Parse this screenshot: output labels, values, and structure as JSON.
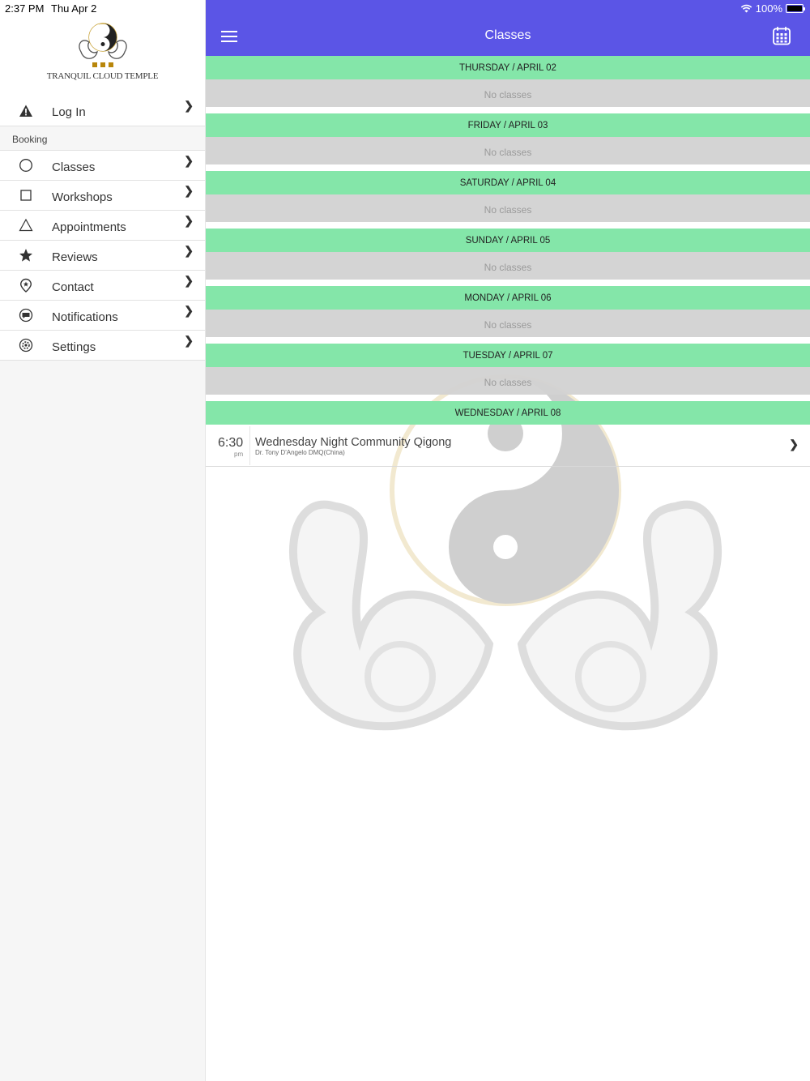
{
  "status": {
    "time": "2:37 PM",
    "date": "Thu Apr 2",
    "battery": "100%"
  },
  "sidebar": {
    "logo_text": "TRANQUIL CLOUD TEMPLE",
    "login": {
      "label": "Log In",
      "icon": "warning-icon"
    },
    "section_label": "Booking",
    "items": [
      {
        "label": "Classes",
        "icon": "circle-icon"
      },
      {
        "label": "Workshops",
        "icon": "square-icon"
      },
      {
        "label": "Appointments",
        "icon": "triangle-icon"
      },
      {
        "label": "Reviews",
        "icon": "star-icon"
      },
      {
        "label": "Contact",
        "icon": "location-pin-icon"
      },
      {
        "label": "Notifications",
        "icon": "chat-bubble-icon"
      },
      {
        "label": "Settings",
        "icon": "gear-icon"
      }
    ]
  },
  "header": {
    "title": "Classes"
  },
  "schedule": {
    "days": [
      {
        "label": "THURSDAY / APRIL 02",
        "empty": "No classes"
      },
      {
        "label": "FRIDAY / APRIL 03",
        "empty": "No classes"
      },
      {
        "label": "SATURDAY / APRIL 04",
        "empty": "No classes"
      },
      {
        "label": "SUNDAY / APRIL 05",
        "empty": "No classes"
      },
      {
        "label": "MONDAY / APRIL 06",
        "empty": "No classes"
      },
      {
        "label": "TUESDAY / APRIL 07",
        "empty": "No classes"
      },
      {
        "label": "WEDNESDAY / APRIL 08"
      }
    ],
    "class": {
      "time": "6:30",
      "ampm": "pm",
      "title": "Wednesday Night Community Qigong",
      "teacher": "Dr. Tony D'Angelo DMQ(China)"
    }
  },
  "colors": {
    "nav": "#5b55e6",
    "day_header": "#84e6a9",
    "empty_row": "#d2d2d2"
  }
}
